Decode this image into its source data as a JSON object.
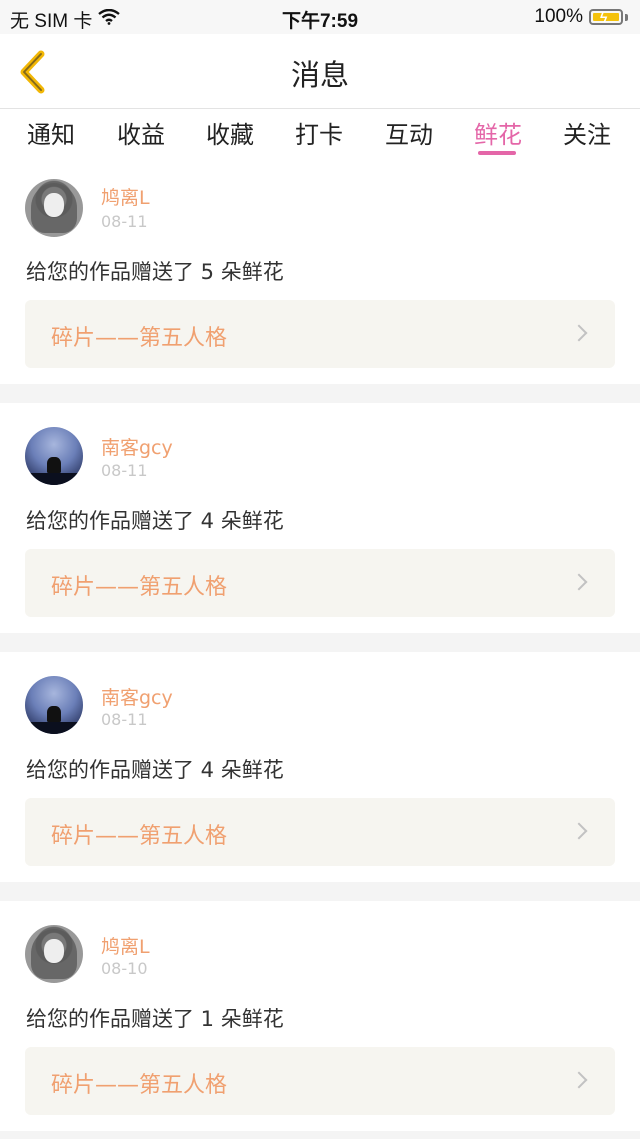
{
  "status_bar": {
    "carrier": "无 SIM 卡",
    "time": "下午7:59",
    "battery": "100%"
  },
  "nav": {
    "title": "消息",
    "back_icon": "chevron-left-icon"
  },
  "tabs": [
    {
      "label": "通知"
    },
    {
      "label": "收益"
    },
    {
      "label": "收藏"
    },
    {
      "label": "打卡"
    },
    {
      "label": "互动"
    },
    {
      "label": "鲜花",
      "active": true
    },
    {
      "label": "关注"
    }
  ],
  "colors": {
    "accent_pink": "#e466a8",
    "accent_orange": "#f0a070"
  },
  "messages": [
    {
      "user": "鸠离L",
      "date": "08-11",
      "text": "给您的作品赠送了 5 朵鲜花",
      "work": "碎片——第五人格",
      "avatar": "girl-avatar"
    },
    {
      "user": "南客gcy",
      "date": "08-11",
      "text": "给您的作品赠送了 4 朵鲜花",
      "work": "碎片——第五人格",
      "avatar": "night-wolf-avatar"
    },
    {
      "user": "南客gcy",
      "date": "08-11",
      "text": "给您的作品赠送了 4 朵鲜花",
      "work": "碎片——第五人格",
      "avatar": "night-wolf-avatar"
    },
    {
      "user": "鸠离L",
      "date": "08-10",
      "text": "给您的作品赠送了 1 朵鲜花",
      "work": "碎片——第五人格",
      "avatar": "girl-avatar"
    }
  ]
}
